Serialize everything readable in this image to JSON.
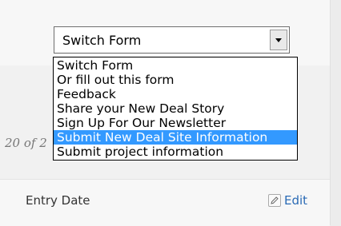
{
  "form_switcher": {
    "selected_value": "Switch Form",
    "options": [
      "Switch Form",
      "Or fill out this form",
      "Feedback",
      "Share your New Deal Story",
      "Sign Up For Our Newsletter",
      "Submit New Deal Site Information",
      "Submit project information"
    ],
    "highlighted_option": "Submit New Deal Site Information"
  },
  "list": {
    "count_text": "20 of 2"
  },
  "entry": {
    "label": "Entry Date",
    "edit_label": "Edit"
  },
  "colors": {
    "highlight": "#3399ff",
    "link": "#2a6ab5"
  },
  "icons": {
    "dropdown_arrow": "chevron-down-icon",
    "edit": "pencil-icon"
  }
}
